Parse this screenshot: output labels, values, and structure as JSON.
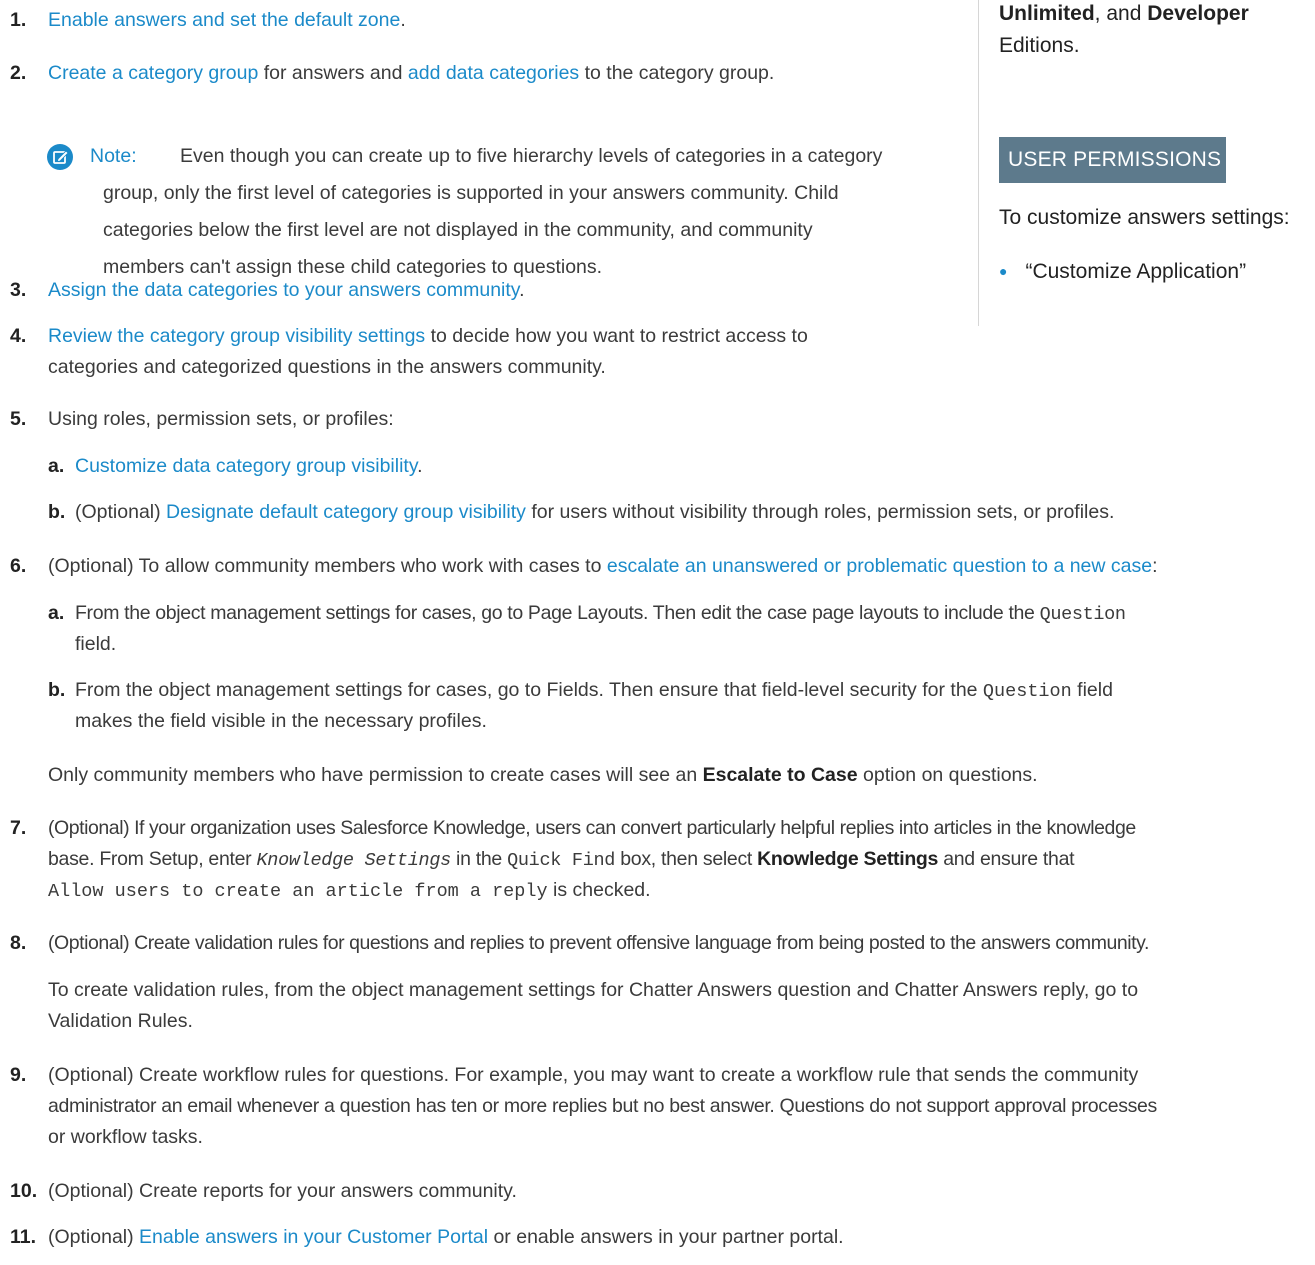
{
  "sidebar": {
    "editions_line1_a": "Unlimited",
    "editions_line1_b": ", and ",
    "editions_line1_c": "Developer",
    "editions_line2": "Editions.",
    "permissions_heading": "USER PERMISSIONS",
    "permissions_text": "To customize answers settings:",
    "permissions_item": "“Customize Application”"
  },
  "steps": {
    "s1": {
      "num": "1.",
      "link": "Enable answers and set the default zone",
      "after": "."
    },
    "s2": {
      "num": "2.",
      "link1": "Create a category group",
      "mid": " for answers and ",
      "link2": "add data categories",
      "after": " to the category group."
    },
    "note": {
      "label": "Note:",
      "line1": "Even though you can create up to five hierarchy levels of categories in a category",
      "line2": "group, only the first level of categories is supported in your answers community. Child",
      "line3": "categories below the first level are not displayed in the community, and community",
      "line4": "members can't assign these child categories to questions."
    },
    "s3": {
      "num": "3.",
      "link": "Assign the data categories to your answers community",
      "after": "."
    },
    "s4": {
      "num": "4.",
      "link": "Review the category group visibility settings",
      "after": " to decide how you want to restrict access to",
      "line2": "categories and categorized questions in the answers community."
    },
    "s5": {
      "num": "5.",
      "text": "Using roles, permission sets, or profiles:",
      "a": {
        "num": "a.",
        "link": "Customize data category group visibility",
        "after": "."
      },
      "b": {
        "num": "b.",
        "before": "(Optional) ",
        "link": "Designate default category group visibility",
        "after": " for users without visibility through roles, permission sets, or profiles."
      }
    },
    "s6": {
      "num": "6.",
      "before": "(Optional) To allow community members who work with cases to ",
      "link": "escalate an unanswered or problematic question to a new case",
      "after": ":",
      "a": {
        "num": "a.",
        "text": "From the object management settings for cases, go to Page Layouts. Then edit the case page layouts to include the ",
        "code": "Question",
        "line2": "field."
      },
      "b": {
        "num": "b.",
        "text": "From the object management settings for cases, go to Fields. Then ensure that field-level security for the ",
        "code": "Question",
        "after": " field",
        "line2": "makes the field visible in the necessary profiles."
      },
      "tail_before": "Only community members who have permission to create cases will see an ",
      "tail_bold": "Escalate to Case",
      "tail_after": " option on questions."
    },
    "s7": {
      "num": "7.",
      "line1": "(Optional) If your organization uses Salesforce Knowledge, users can convert particularly helpful replies into articles in the knowledge",
      "l2_a": "base. From Setup, enter ",
      "l2_code_i": "Knowledge Settings",
      "l2_b": " in the ",
      "l2_code": "Quick Find",
      "l2_c": " box, then select ",
      "l2_bold": "Knowledge Settings",
      "l2_d": " and ensure that",
      "l3_code": "Allow users to create an article from a reply",
      "l3_after": " is checked."
    },
    "s8": {
      "num": "8.",
      "line1": "(Optional) Create validation rules for questions and replies to prevent offensive language from being posted to the answers community.",
      "line2": "To create validation rules, from the object management settings for Chatter Answers question and Chatter Answers reply, go to",
      "line3": "Validation Rules."
    },
    "s9": {
      "num": "9.",
      "line1": "(Optional) Create workflow rules for questions. For example, you may want to create a workflow rule that sends the community",
      "line2": "administrator an email whenever a question has ten or more replies but no best answer. Questions do not support approval processes",
      "line3": "or workflow tasks."
    },
    "s10": {
      "num": "10.",
      "text": "(Optional) Create reports for your answers community."
    },
    "s11": {
      "num": "11.",
      "before": "(Optional) ",
      "link": "Enable answers in your Customer Portal",
      "after": " or enable answers in your partner portal."
    }
  }
}
